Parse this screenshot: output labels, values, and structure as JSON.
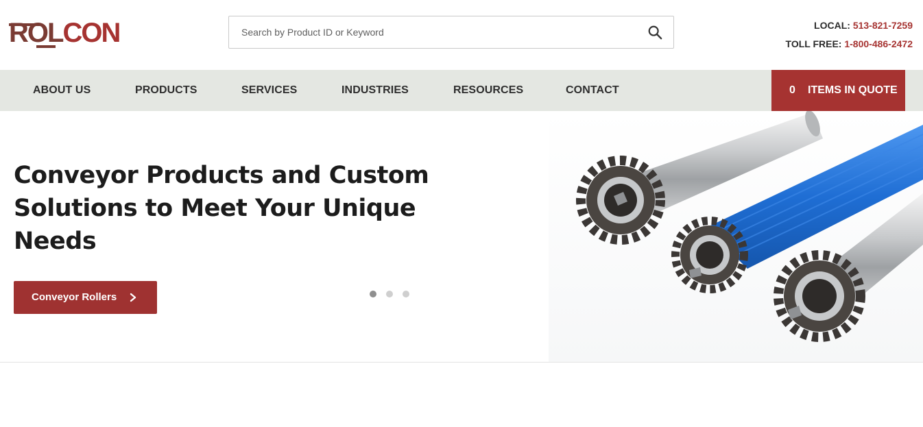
{
  "brand": {
    "logo_part1": "ROL",
    "logo_part2": "CON",
    "logo_alt": "Rolcon"
  },
  "search": {
    "placeholder": "Search by Product ID or Keyword",
    "value": ""
  },
  "contact": {
    "local_label": "LOCAL:",
    "local_number": "513-821-7259",
    "tollfree_label": "TOLL FREE:",
    "tollfree_number": "1-800-486-2472"
  },
  "nav": {
    "items": [
      {
        "label": "ABOUT US"
      },
      {
        "label": "PRODUCTS"
      },
      {
        "label": "SERVICES"
      },
      {
        "label": "INDUSTRIES"
      },
      {
        "label": "RESOURCES"
      },
      {
        "label": "CONTACT"
      }
    ],
    "quote_count": "0",
    "quote_label": "ITEMS IN QUOTE"
  },
  "hero": {
    "title": "Conveyor Products and Custom Solutions to Meet Your Unique Needs",
    "button_label": "Conveyor Rollers",
    "slide_count": 3,
    "active_slide": 1,
    "image_subject": "conveyor-rollers-with-sprockets"
  },
  "colors": {
    "accent": "#a63331",
    "nav_bg": "#e4e7e2",
    "logo_dark": "#7a3b33",
    "roller_blue": "#1f6ed4"
  }
}
